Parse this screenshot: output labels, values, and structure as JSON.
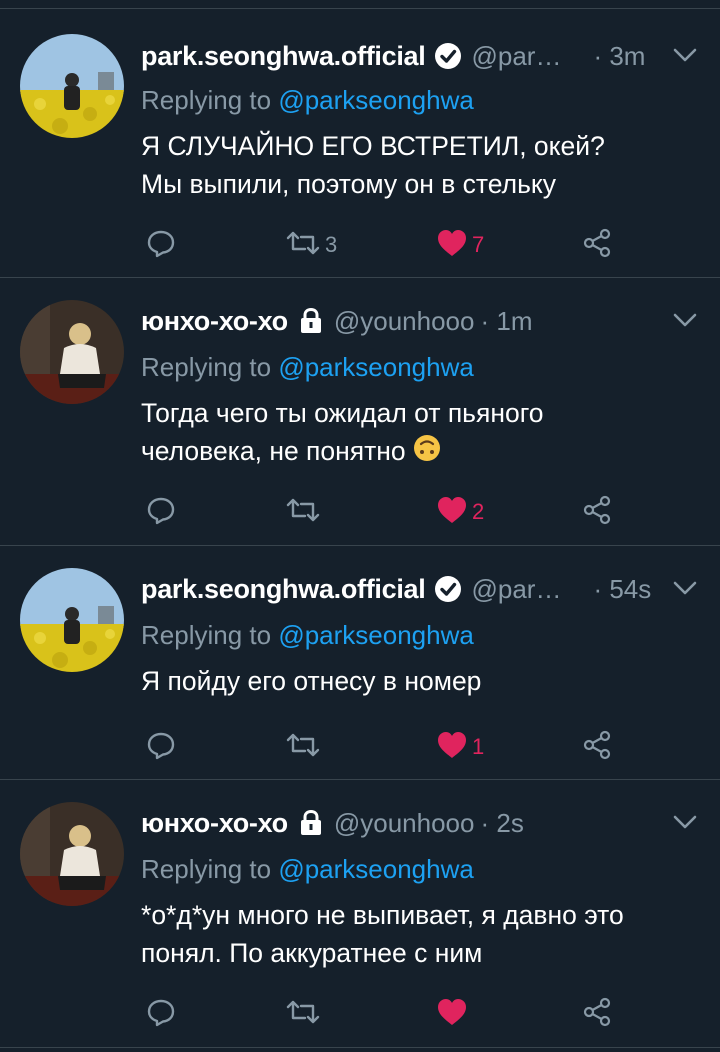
{
  "tweets": [
    {
      "display_name": "park.seonghwa.official",
      "handle": "@par…",
      "time": "· 3m",
      "badge": "verified-icon",
      "reply_prefix": "Replying to ",
      "reply_to": "@parkseonghwa",
      "text_lines": [
        "Я СЛУЧАЙНО ЕГО ВСТРЕТИЛ, окей?",
        "Мы выпили, поэтому он в стельку"
      ],
      "retweets": "3",
      "likes": "7",
      "liked": true
    },
    {
      "display_name": "юнхо-хо-хо",
      "handle": "@younhooo",
      "time": "· 1m",
      "badge": "lock-icon",
      "reply_prefix": "Replying to ",
      "reply_to": "@parkseonghwa",
      "text_lines": [
        "Тогда чего ты ожидал от пьяного",
        "человека, не понятно"
      ],
      "emoji": "upside-down-face-icon",
      "retweets": "",
      "likes": "2",
      "liked": true
    },
    {
      "display_name": "park.seonghwa.official",
      "handle": "@par…",
      "time": "· 54s",
      "badge": "verified-icon",
      "reply_prefix": "Replying to ",
      "reply_to": "@parkseonghwa",
      "text_lines": [
        "Я пойду его отнесу в номер"
      ],
      "retweets": "",
      "likes": "1",
      "liked": true
    },
    {
      "display_name": "юнхо-хо-хо",
      "handle": "@younhooo",
      "time": "· 2s",
      "badge": "lock-icon",
      "reply_prefix": "Replying to ",
      "reply_to": "@parkseonghwa",
      "text_lines": [
        "*о*д*ун много не выпивает, я давно это",
        "понял. По аккуратнее с ним"
      ],
      "retweets": "",
      "likes": "",
      "liked": true
    }
  ],
  "colors": {
    "background": "#15202b",
    "divider": "#38444d",
    "muted": "#8899a6",
    "mention": "#1da1f2",
    "like": "#e0245e"
  }
}
